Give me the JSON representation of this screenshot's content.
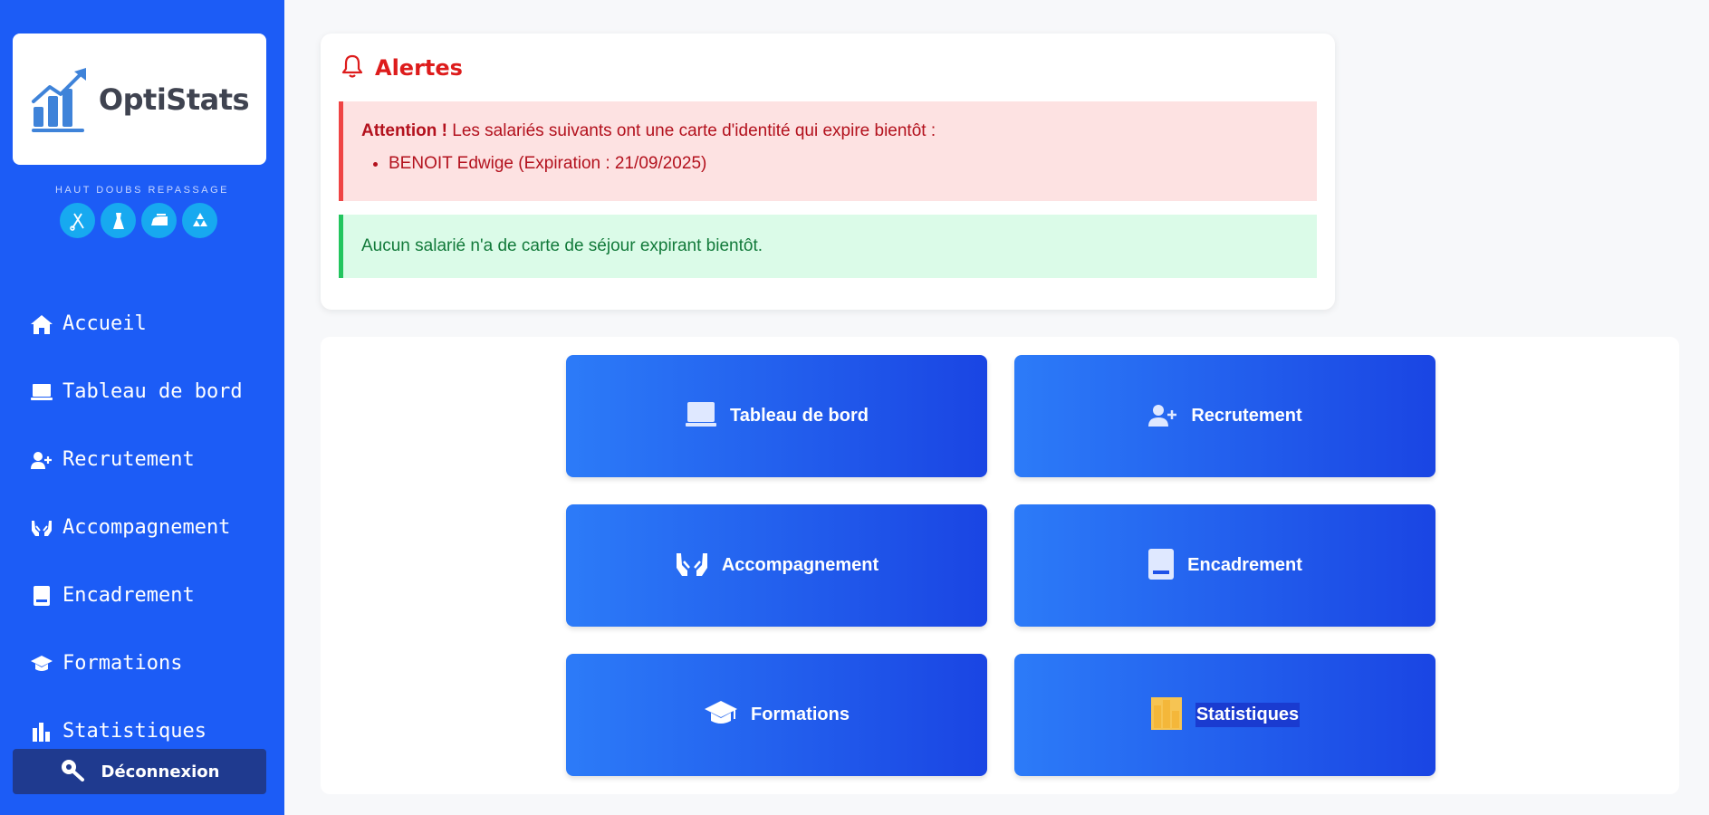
{
  "brand": {
    "name": "OptiStats",
    "logo_icon": "growth-chart-icon",
    "accent": "#1c5cf6"
  },
  "partner": {
    "name": "HAUT DOUBS REPASSAGE",
    "icons": [
      "sewing-icon",
      "dress-icon",
      "iron-icon",
      "recycle-icon"
    ]
  },
  "nav": [
    {
      "label": "Accueil",
      "icon": "home-icon"
    },
    {
      "label": "Tableau de bord",
      "icon": "laptop-icon"
    },
    {
      "label": "Recrutement",
      "icon": "user-plus-icon"
    },
    {
      "label": "Accompagnement",
      "icon": "hands-icon"
    },
    {
      "label": "Encadrement",
      "icon": "book-icon"
    },
    {
      "label": "Formations",
      "icon": "graduation-cap-icon"
    },
    {
      "label": "Statistiques",
      "icon": "bar-chart-icon"
    }
  ],
  "logout": {
    "label": "Déconnexion",
    "icon": "key-icon"
  },
  "alerts": {
    "title": "Alertes",
    "danger": {
      "strong": "Attention !",
      "text": " Les salariés suivants ont une carte d'identité qui expire bientôt :",
      "items": [
        "BENOIT Edwige (Expiration : 21/09/2025)"
      ],
      "color": "#b3111d"
    },
    "success": {
      "text": "Aucun salarié n'a de carte de séjour expirant bientôt.",
      "color": "#127a3a"
    }
  },
  "tiles": [
    {
      "label": "Tableau de bord",
      "icon": "laptop-icon"
    },
    {
      "label": "Recrutement",
      "icon": "user-plus-icon"
    },
    {
      "label": "Accompagnement",
      "icon": "hands-icon"
    },
    {
      "label": "Encadrement",
      "icon": "book-icon"
    },
    {
      "label": "Formations",
      "icon": "graduation-cap-icon"
    },
    {
      "label": "Statistiques",
      "icon": "bar-chart-icon"
    }
  ]
}
